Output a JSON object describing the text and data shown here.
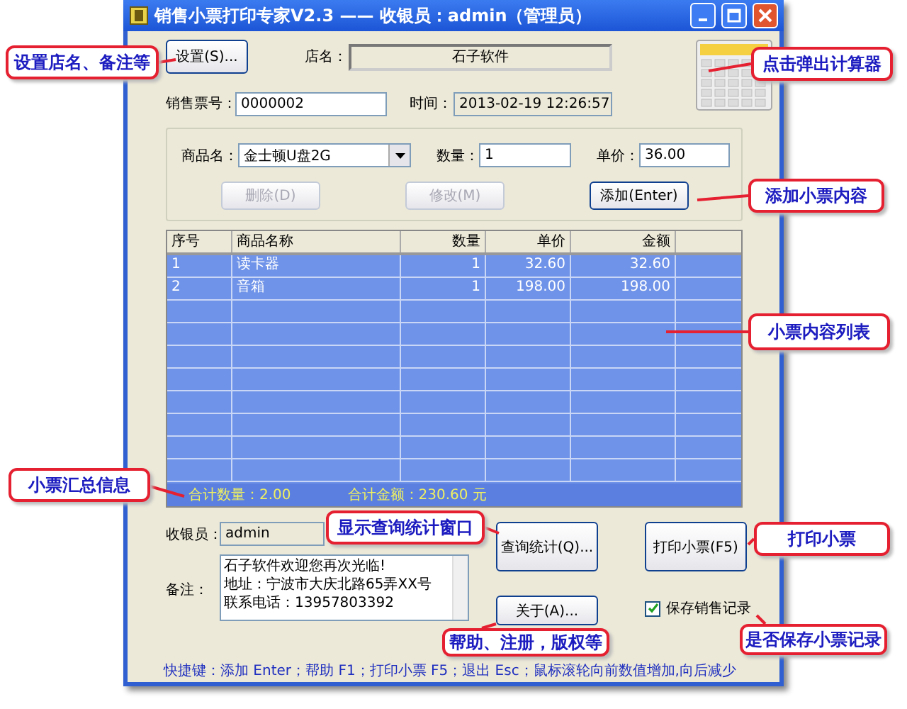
{
  "window": {
    "title": "销售小票打印专家V2.3 —— 收银员：admin（管理员）"
  },
  "settings_button": "设置(S)...",
  "shop": {
    "label": "店名：",
    "value": "石子软件"
  },
  "ticket_no": {
    "label": "销售票号：",
    "value": "0000002"
  },
  "time": {
    "label": "时间：",
    "value": "2013-02-19 12:26:57"
  },
  "product": {
    "label": "商品名：",
    "value": "金士顿U盘2G"
  },
  "quantity": {
    "label": "数量：",
    "value": "1"
  },
  "price": {
    "label": "单价：",
    "value": "36.00"
  },
  "item_buttons": [
    {
      "label": "删除(D)",
      "disabled": true
    },
    {
      "label": "修改(M)",
      "disabled": true
    },
    {
      "label": "添加(Enter)",
      "disabled": false
    }
  ],
  "table": {
    "columns": [
      "序号",
      "商品名称",
      "数量",
      "单价",
      "金额"
    ],
    "rows": [
      [
        "1",
        "读卡器",
        "1",
        "32.60",
        "32.60"
      ],
      [
        "2",
        "音箱",
        "1",
        "198.00",
        "198.00"
      ]
    ]
  },
  "summary": {
    "quantity": "合计数量：2.00",
    "amount": "合计金额：230.60 元"
  },
  "cashier": {
    "label": "收银员：",
    "value": "admin"
  },
  "note": {
    "label": "备注：",
    "lines": [
      "石子软件欢迎您再次光临!",
      "地址：宁波市大庆北路65弄XX号",
      "联系电话：13957803392"
    ]
  },
  "query_button": "查询统计(Q)...",
  "print_button": "打印小票(F5)",
  "about_button": "关于(A)...",
  "save_record": {
    "label": "保存销售记录",
    "checked": true
  },
  "status_bar": "快捷键：添加 Enter；帮助 F1；打印小票 F5；退出 Esc；鼠标滚轮向前数值增加,向后减少",
  "callouts": [
    "设置店名、备注等",
    "点击弹出计算器",
    "添加小票内容",
    "小票内容列表",
    "小票汇总信息",
    "显示查询统计窗口",
    "打印小票",
    "帮助、注册，版权等",
    "是否保存小票记录"
  ]
}
